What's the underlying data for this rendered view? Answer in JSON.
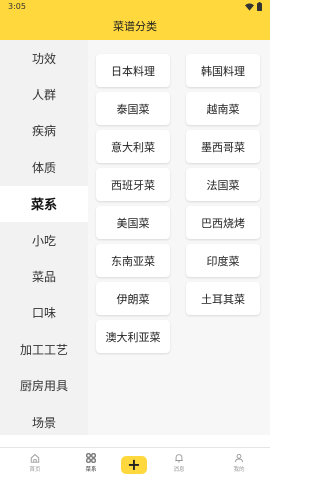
{
  "status_bar": {
    "time": "3:05"
  },
  "header": {
    "title": "菜谱分类"
  },
  "sidebar": {
    "items": [
      {
        "label": "功效",
        "active": false
      },
      {
        "label": "人群",
        "active": false
      },
      {
        "label": "疾病",
        "active": false
      },
      {
        "label": "体质",
        "active": false
      },
      {
        "label": "菜系",
        "active": true
      },
      {
        "label": "小吃",
        "active": false
      },
      {
        "label": "菜品",
        "active": false
      },
      {
        "label": "口味",
        "active": false
      },
      {
        "label": "加工工艺",
        "active": false
      },
      {
        "label": "厨房用具",
        "active": false
      },
      {
        "label": "场景",
        "active": false
      }
    ]
  },
  "categories": [
    "日本料理",
    "韩国料理",
    "泰国菜",
    "越南菜",
    "意大利菜",
    "墨西哥菜",
    "西班牙菜",
    "法国菜",
    "美国菜",
    "巴西烧烤",
    "东南亚菜",
    "印度菜",
    "伊朗菜",
    "土耳其菜",
    "澳大利亚菜"
  ],
  "tab_bar": {
    "tabs": [
      {
        "label": "首页",
        "icon": "home-icon",
        "active": false
      },
      {
        "label": "菜系",
        "icon": "grid-icon",
        "active": true
      },
      {
        "label": "",
        "icon": "plus-icon",
        "active": false
      },
      {
        "label": "消息",
        "icon": "bell-icon",
        "active": false
      },
      {
        "label": "我的",
        "icon": "user-icon",
        "active": false
      }
    ],
    "add_symbol": "+"
  },
  "colors": {
    "accent": "#ffd83d",
    "sidebar_bg": "#f2f2f2",
    "grid_bg": "#f7f7f7"
  }
}
